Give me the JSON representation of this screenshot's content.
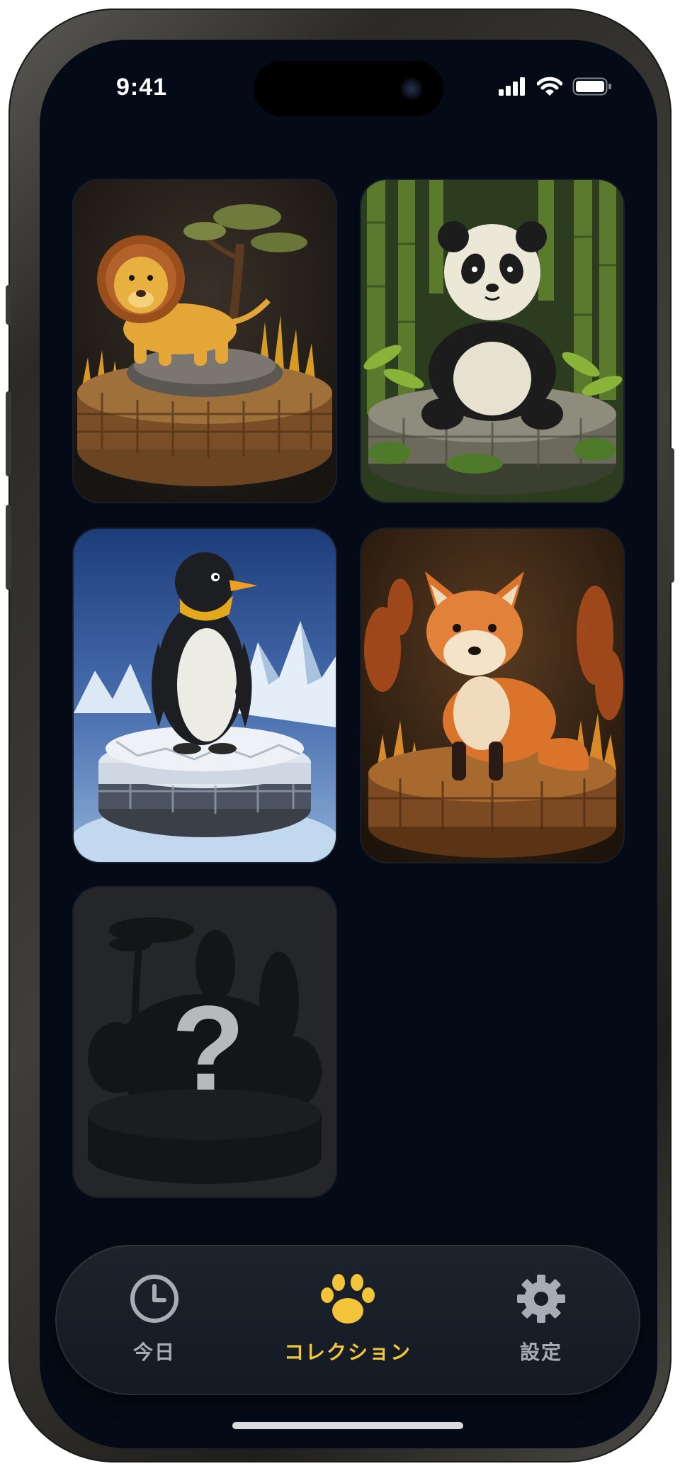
{
  "status_bar": {
    "time": "9:41"
  },
  "collection": {
    "cards": [
      {
        "animal": "lion",
        "locked": false
      },
      {
        "animal": "panda",
        "locked": false
      },
      {
        "animal": "penguin",
        "locked": false
      },
      {
        "animal": "fox",
        "locked": false
      },
      {
        "animal": "unknown",
        "locked": true,
        "mark": "?"
      }
    ]
  },
  "tab_bar": {
    "tabs": [
      {
        "label": "今日",
        "icon": "clock-icon",
        "active": false
      },
      {
        "label": "コレクション",
        "icon": "paw-icon",
        "active": true
      },
      {
        "label": "設定",
        "icon": "gear-icon",
        "active": false
      }
    ]
  },
  "colors": {
    "background": "#050b16",
    "accent": "#f3c43a",
    "inactive": "#a8adb3"
  }
}
